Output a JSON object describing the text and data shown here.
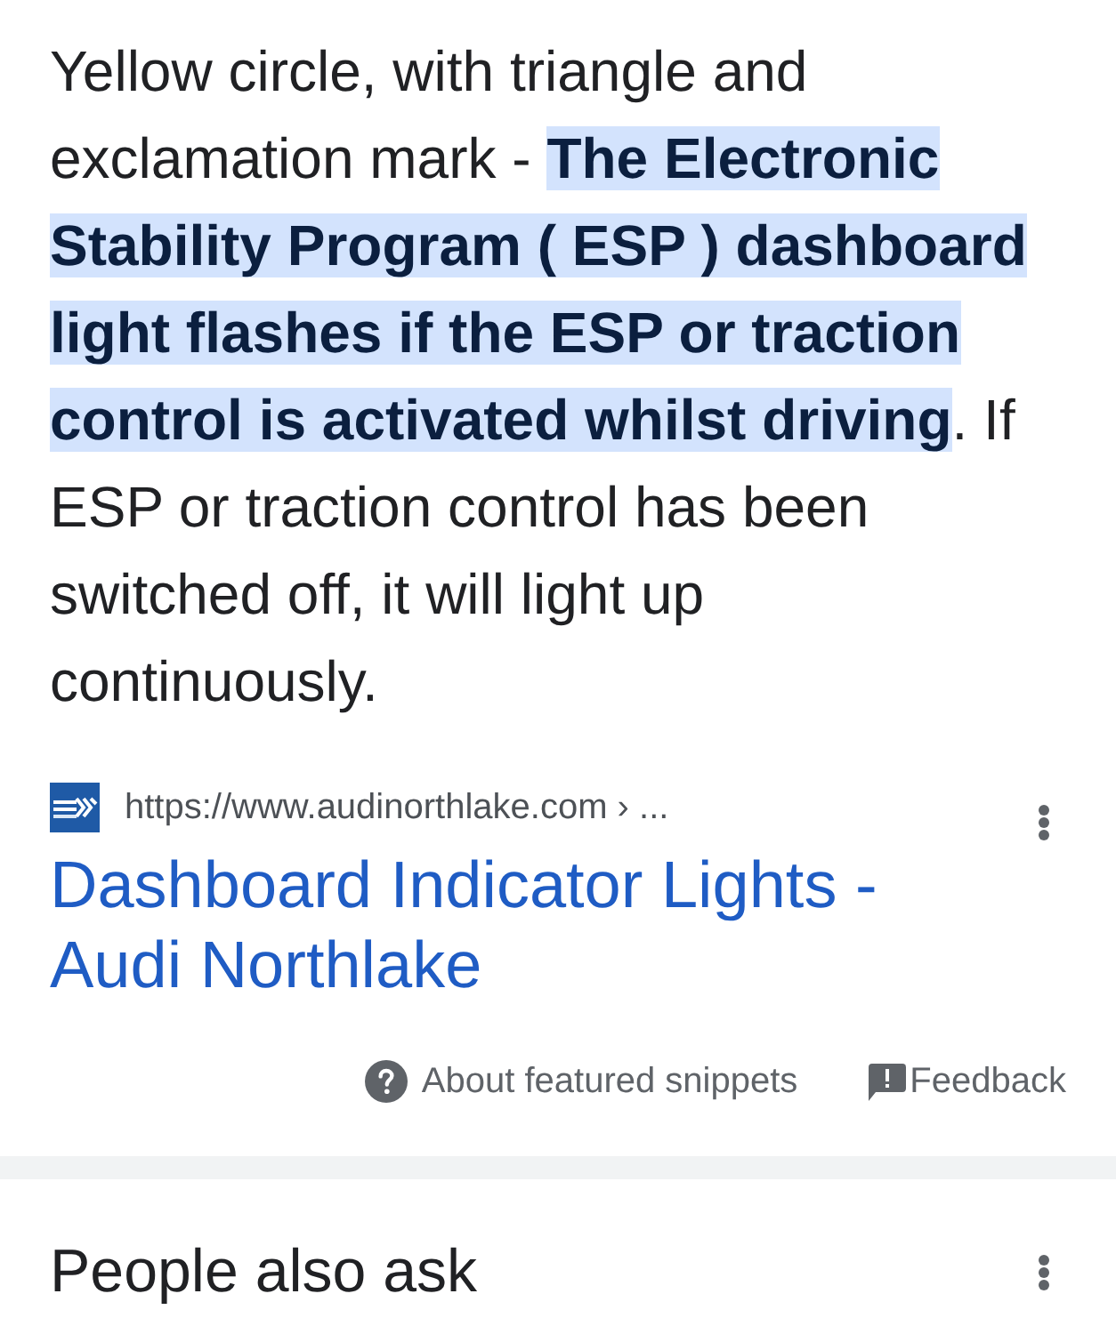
{
  "snippet": {
    "segments": [
      {
        "text": "Yellow circle, with triangle and exclamation mark - ",
        "highlighted": false
      },
      {
        "text": "The Electronic Stability Program ( ESP ) dashboard light flashes if the ESP or traction control is activated whilst driving",
        "highlighted": true
      },
      {
        "text": ". If ESP or traction control has been switched off, it will light up continuously.",
        "highlighted": false
      }
    ]
  },
  "source": {
    "url": "https://www.audinorthlake.com › ...",
    "title": "Dashboard Indicator Lights - Audi Northlake"
  },
  "footer": {
    "about": "About featured snippets",
    "feedback": "Feedback"
  },
  "people_also_ask": {
    "heading": "People also ask"
  }
}
